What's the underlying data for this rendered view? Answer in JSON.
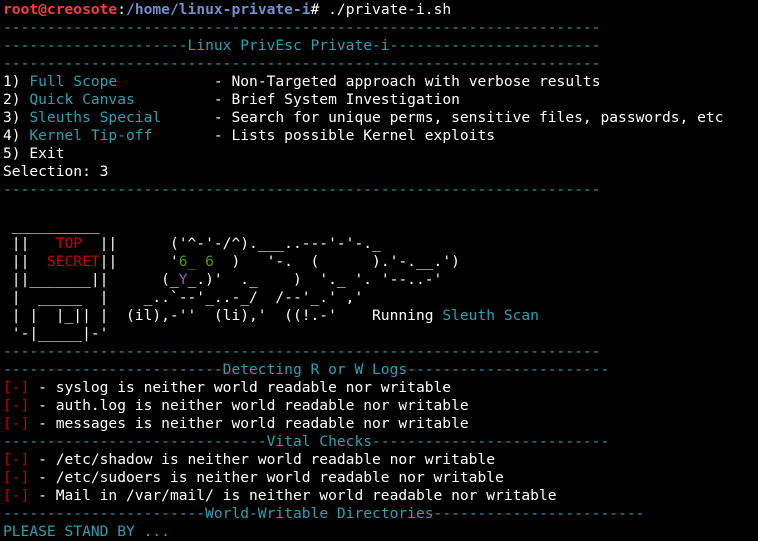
{
  "prompt": {
    "user_host": "root@creosote",
    "colon": ":",
    "path": "/home/linux-private-i",
    "symbol": "#",
    "command": " ./private-i.sh"
  },
  "separators": {
    "full": "--------------------------------------------------------------------",
    "title_left": "---------------------",
    "title_text": "Linux PrivEsc Private-i",
    "title_right": "------------------------"
  },
  "menu": {
    "items": [
      {
        "num": "1) ",
        "name": "Full Scope",
        "pad": "           ",
        "desc": "- Non-Targeted approach with verbose results"
      },
      {
        "num": "2) ",
        "name": "Quick Canvas",
        "pad": "         ",
        "desc": "- Brief System Investigation"
      },
      {
        "num": "3) ",
        "name": "Sleuths Special",
        "pad": "      ",
        "desc": "- Search for unique perms, sensitive files, passwords, etc"
      },
      {
        "num": "4) ",
        "name": "Kernel Tip-off",
        "pad": "       ",
        "desc": "- Lists possible Kernel exploits"
      }
    ],
    "exit": "5) Exit",
    "selection": "Selection: 3"
  },
  "banner": {
    "l1": " __________",
    "l1r": "",
    "l2a": " ||   ",
    "l2_top": "TOP",
    "l2b": "  ||      ('^-'-/^).___..---'-'-._",
    "l3a": " ||  ",
    "l3_secret": "SECRET",
    "l3b": "||      '",
    "l3_six1": "6_ 6",
    "l3c": "  )   '-.  (      ).'-.__.')",
    "l4a": " ||_______||      (_",
    "l4_y": "Y",
    "l4b": "_.)'  ._    )  '._ '. '--..-'",
    "l5": " |  _____  |    _..`--'_..-_/  /--'_.' ,'",
    "l6a": " | |  |_|| |  (il),-''  (li),'  ((!.-'    Running ",
    "l6_sleuth": "Sleuth Scan",
    "l7": " '-|_____|-'"
  },
  "sections": {
    "logs_left": "-------------------------",
    "logs_title": "Detecting R or W Logs",
    "logs_right": "-----------------------",
    "vital_left": "------------------------------",
    "vital_title": "Vital Checks",
    "vital_right": "---------------------------",
    "ww_left": "-----------------------",
    "ww_title": "World-Writable Directories",
    "ww_right": "------------------------"
  },
  "results": {
    "marker": "[-]",
    "logs": [
      " - syslog is neither world readable nor writable",
      " - auth.log is neither world readable nor writable",
      " - messages is neither world readable nor writable"
    ],
    "vital": [
      " - /etc/shadow is neither world readable nor writable",
      " - /etc/sudoers is neither world readable nor writable",
      " - Mail in /var/mail/ is neither world readable nor writable"
    ]
  },
  "status": "PLEASE STAND BY ...",
  "colors": {
    "background": "#000000",
    "foreground": "#ffffff",
    "teal": "#2aa1b3",
    "red": "#cd0000",
    "path_blue": "#6f8fd0"
  }
}
